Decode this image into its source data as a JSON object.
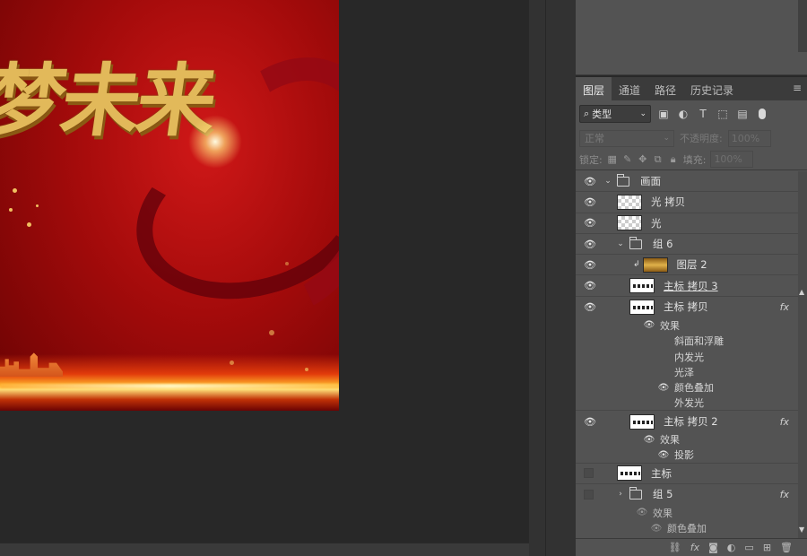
{
  "canvas": {
    "banner_title": "梦未来"
  },
  "panel": {
    "tabs": [
      "图层",
      "通道",
      "路径",
      "历史记录"
    ],
    "filter_kind": "类型",
    "blend_mode": "正常",
    "opacity_label": "不透明度:",
    "opacity_value": "100%",
    "lock_label": "锁定:",
    "fill_label": "填充:",
    "fill_value": "100%"
  },
  "layers": {
    "group_huamian": "画面",
    "guang_copy": "光 拷贝",
    "guang": "光",
    "group6": "组 6",
    "layer2": "图层 2",
    "zhubiao_copy3": "主标 拷贝 3",
    "zhubiao_copy": "主标 拷贝",
    "effects": "效果",
    "bevel": "斜面和浮雕",
    "inner_glow": "内发光",
    "satin": "光泽",
    "color_overlay": "颜色叠加",
    "outer_glow": "外发光",
    "zhubiao_copy2": "主标 拷贝 2",
    "effects2": "效果",
    "drop_shadow": "投影",
    "zhubiao": "主标",
    "group5": "组 5",
    "effects3": "效果",
    "color_overlay2": "颜色叠加",
    "fx": "fx"
  },
  "colors": {
    "panel_bg": "#535353",
    "banner_red": "#c81010",
    "gold": "#e2b95a"
  }
}
